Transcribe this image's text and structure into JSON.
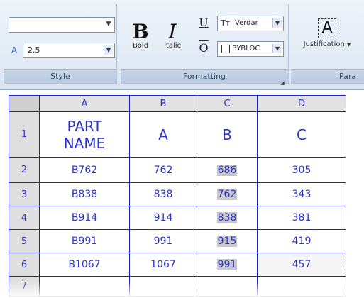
{
  "ribbon": {
    "style_panel": {
      "title": "Style",
      "style_dropdown_value": "",
      "text_height_value": "2.5"
    },
    "formatting_panel": {
      "title": "Formatting",
      "bold_label": "Bold",
      "italic_label": "Italic",
      "bold_glyph": "B",
      "italic_glyph": "I",
      "underline_glyph": "U",
      "overline_glyph": "O",
      "font_value": "Verdar",
      "color_value": "BYBLOC"
    },
    "paragraph_panel": {
      "title": "Para",
      "justification_label": "Justification",
      "justification_glyph": "A"
    }
  },
  "table": {
    "column_headers": [
      "A",
      "B",
      "C",
      "D"
    ],
    "rows": [
      {
        "num": "1",
        "cells": [
          "PART NAME",
          "A",
          "B",
          "C"
        ]
      },
      {
        "num": "2",
        "cells": [
          "B762",
          "762",
          "686",
          "305"
        ]
      },
      {
        "num": "3",
        "cells": [
          "B838",
          "838",
          "762",
          "343"
        ]
      },
      {
        "num": "4",
        "cells": [
          "B914",
          "914",
          "838",
          "381"
        ]
      },
      {
        "num": "5",
        "cells": [
          "B991",
          "991",
          "915",
          "419"
        ]
      },
      {
        "num": "6",
        "cells": [
          "B1067",
          "1067",
          "991",
          "457"
        ]
      },
      {
        "num": "7",
        "cells": [
          "",
          "",
          "",
          ""
        ]
      }
    ]
  },
  "colors": {
    "table_text": "#2a34c8",
    "grid_line": "#1b23c8",
    "header_bg": "#e2e2e2",
    "highlight": "#c8c8c8"
  }
}
